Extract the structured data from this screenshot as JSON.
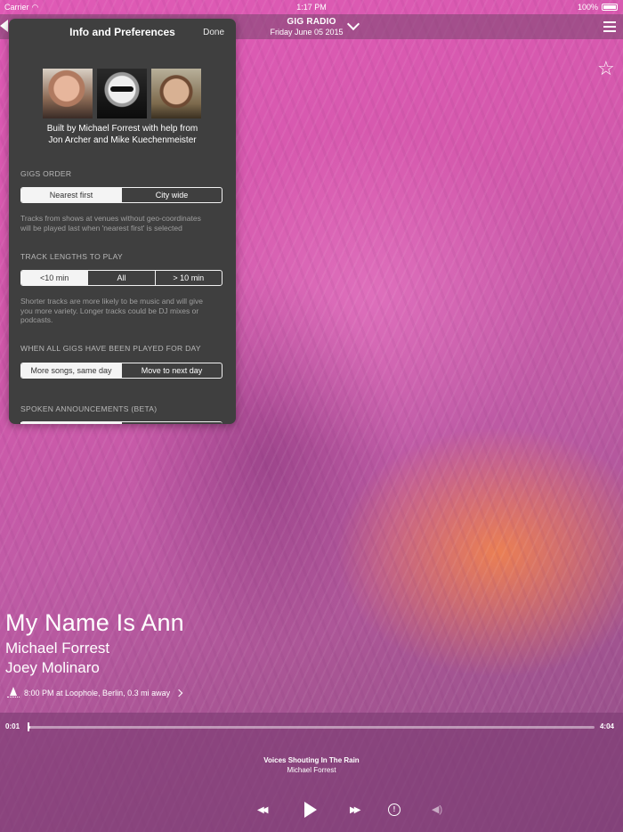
{
  "status_bar": {
    "carrier": "Carrier",
    "time": "1:17 PM",
    "battery": "100%"
  },
  "header": {
    "title": "GIG RADIO",
    "date": "Friday June 05 2015"
  },
  "panel": {
    "title": "Info and Preferences",
    "done_label": "Done",
    "credits_line1": "Built by Michael Forrest with help from",
    "credits_line2": "Jon Archer and Mike Kuechenmeister",
    "gigs_order": {
      "label": "GIGS ORDER",
      "options": [
        "Nearest first",
        "City wide"
      ],
      "selected": "Nearest first",
      "note_line1": "Tracks from shows at venues without geo-coordinates",
      "note_line2": "will be played last when 'nearest first' is selected"
    },
    "track_lengths": {
      "label": "TRACK LENGTHS TO PLAY",
      "options": [
        "<10 min",
        "All",
        "> 10 min"
      ],
      "selected": "<10 min",
      "note_line1": "Shorter tracks are more likely to be music and will give",
      "note_line2": "you more variety. Longer tracks could be DJ mixes or",
      "note_line3": "podcasts."
    },
    "when_played": {
      "label": "WHEN ALL GIGS HAVE BEEN PLAYED FOR DAY",
      "options": [
        "More songs, same day",
        "Move to next day"
      ],
      "selected": "More songs, same day"
    },
    "spoken": {
      "label": "SPOKEN ANNOUNCEMENTS (BETA)"
    }
  },
  "song": {
    "title": "My Name Is Ann",
    "artist": "Michael Forrest",
    "artist2": "Joey Molinaro",
    "venue": "8:00 PM at Loophole, Berlin, 0.3 mi away"
  },
  "player": {
    "elapsed": "0:01",
    "duration": "4:04",
    "progress_fraction": 0.004,
    "now_playing_title": "Voices Shouting In The Rain",
    "now_playing_artist": "Michael Forrest"
  },
  "icons": [
    "wifi-icon",
    "battery-icon",
    "back-arrow-icon",
    "chevron-down-icon",
    "menu-icon",
    "star-icon",
    "location-icon",
    "chevron-right-icon",
    "rewind-icon",
    "play-icon",
    "fast-forward-icon",
    "info-icon",
    "volume-icon"
  ]
}
